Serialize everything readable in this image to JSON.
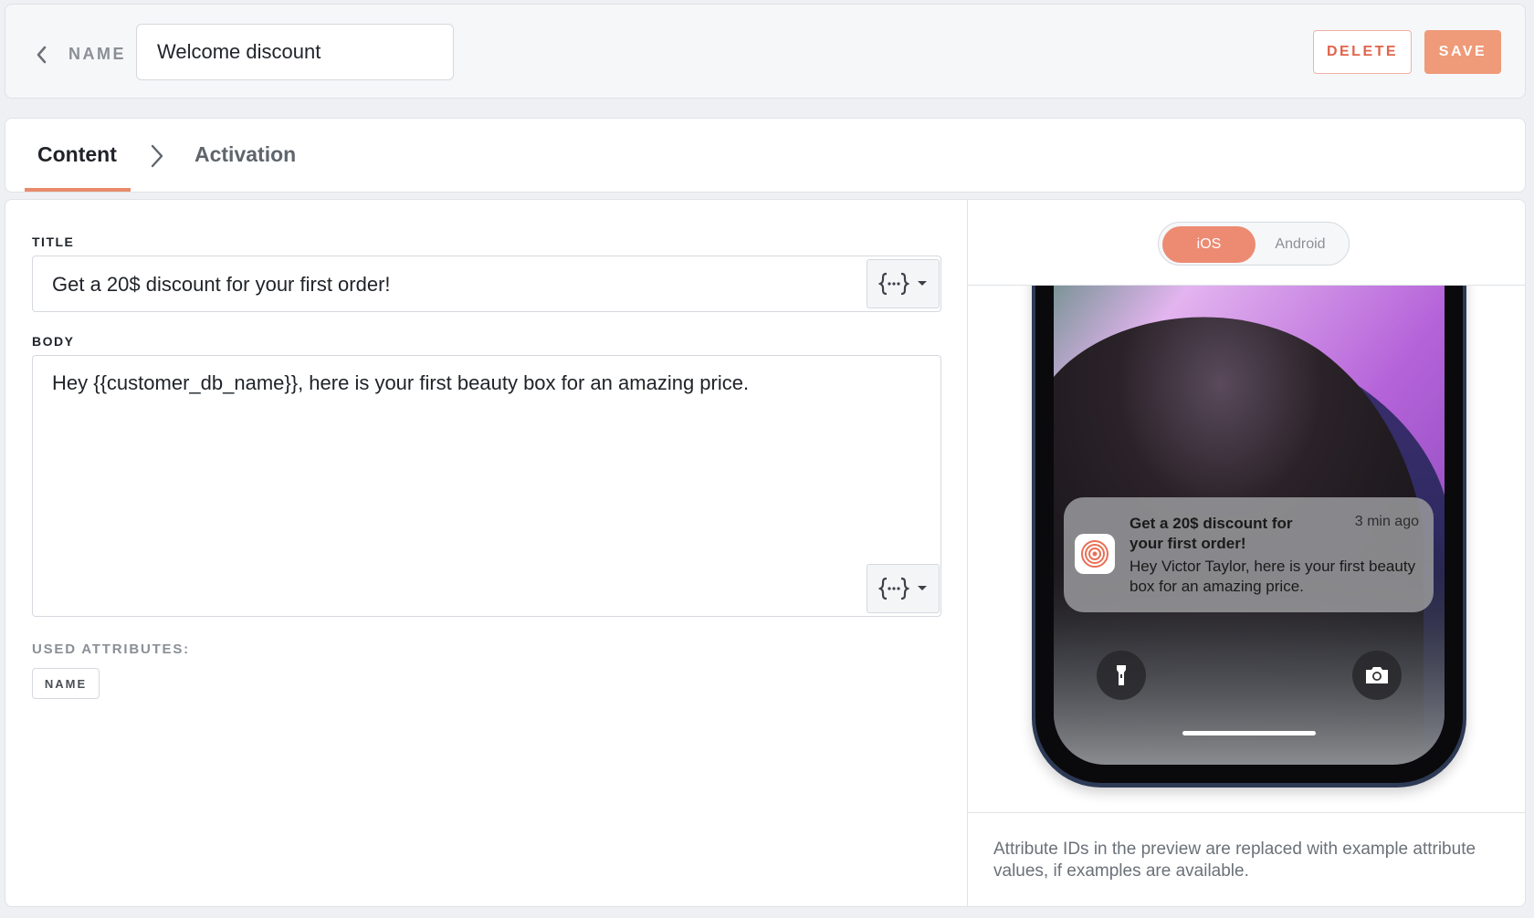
{
  "header": {
    "back_icon": "chevron-left-icon",
    "name_label": "NAME",
    "name_value": "Welcome discount",
    "delete_label": "DELETE",
    "save_label": "SAVE",
    "accent_color": "#ef9a78"
  },
  "tabs": [
    {
      "label": "Content",
      "active": true
    },
    {
      "label": "Activation",
      "active": false
    }
  ],
  "content": {
    "title_label": "TITLE",
    "title_value": "Get a 20$ discount for your first order!",
    "body_label": "BODY",
    "body_value": "Hey {{customer_db_name}}, here is your first beauty box for an amazing price.",
    "used_attributes_label": "USED ATTRIBUTES:",
    "used_attributes": [
      "NAME"
    ],
    "attribute_insert_icon": "curly-braces-icon"
  },
  "preview": {
    "platforms": [
      "iOS",
      "Android"
    ],
    "selected_platform": "iOS",
    "notification": {
      "title": "Get a 20$ discount for your first order!",
      "time": "3 min ago",
      "body": "Hey Victor Taylor, here is your first beauty box for an amazing price."
    },
    "disclaimer": "Attribute IDs in the preview are replaced with example attribute values, if examples are available."
  }
}
